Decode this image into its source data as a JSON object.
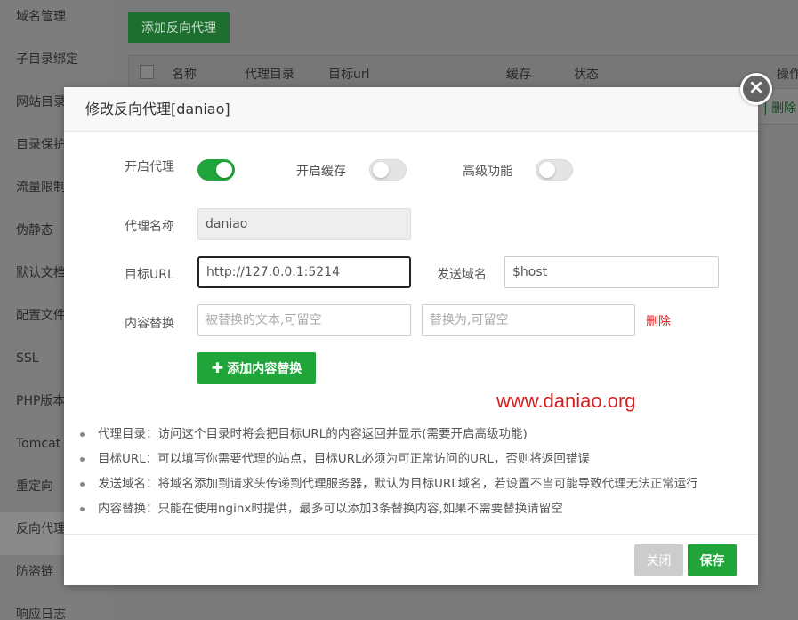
{
  "sidebar": {
    "items": [
      {
        "label": "域名管理"
      },
      {
        "label": "子目录绑定"
      },
      {
        "label": "网站目录"
      },
      {
        "label": "目录保护"
      },
      {
        "label": "流量限制"
      },
      {
        "label": "伪静态"
      },
      {
        "label": "默认文档"
      },
      {
        "label": "配置文件"
      },
      {
        "label": "SSL"
      },
      {
        "label": "PHP版本"
      },
      {
        "label": "Tomcat"
      },
      {
        "label": "重定向"
      },
      {
        "label": "反向代理"
      },
      {
        "label": "防盗链"
      },
      {
        "label": "响应日志"
      }
    ],
    "active_index": 12
  },
  "main": {
    "add_button": "添加反向代理",
    "table": {
      "columns": [
        "名称",
        "代理目录",
        "目标url",
        "缓存",
        "状态",
        "操作"
      ],
      "row_action": "| 删除"
    }
  },
  "modal": {
    "title": "修改反向代理[daniao]",
    "close_icon": "×",
    "enable_proxy": {
      "label": "开启代理",
      "on": true
    },
    "enable_cache": {
      "label": "开启缓存",
      "on": false
    },
    "advanced": {
      "label": "高级功能",
      "on": false
    },
    "proxy_name": {
      "label": "代理名称",
      "value": "daniao"
    },
    "target_url": {
      "label": "目标URL",
      "value": "http://127.0.0.1:5214"
    },
    "send_domain": {
      "label": "发送域名",
      "value": "$host"
    },
    "content_replace": {
      "label": "内容替换",
      "from_placeholder": "被替换的文本,可留空",
      "to_placeholder": "替换为,可留空",
      "delete_label": "删除"
    },
    "add_replace_button": "添加内容替换",
    "watermark": "www.daniao.org",
    "notes": [
      "代理目录：访问这个目录时将会把目标URL的内容返回并显示(需要开启高级功能)",
      "目标URL：可以填写你需要代理的站点，目标URL必须为可正常访问的URL，否则将返回错误",
      "发送域名：将域名添加到请求头传递到代理服务器，默认为目标URL域名，若设置不当可能导致代理无法正常运行",
      "内容替换：只能在使用nginx时提供，最多可以添加3条替换内容,如果不需要替换请留空"
    ],
    "footer": {
      "close": "关闭",
      "save": "保存"
    }
  },
  "colors": {
    "accent": "#20a53a",
    "danger": "#e02020",
    "overlay": "#7a7a7a"
  }
}
